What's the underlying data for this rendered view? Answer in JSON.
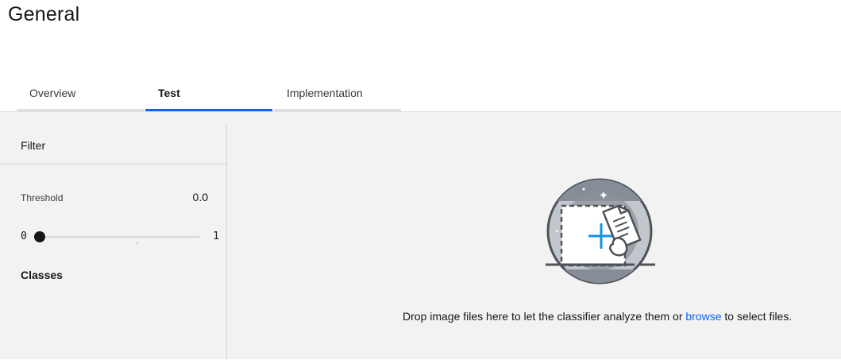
{
  "page": {
    "title": "General"
  },
  "tabs": [
    {
      "label": "Overview",
      "active": false
    },
    {
      "label": "Test",
      "active": true
    },
    {
      "label": "Implementation",
      "active": false
    }
  ],
  "sidebar": {
    "filter_label": "Filter",
    "threshold": {
      "label": "Threshold",
      "value": "0.0"
    },
    "slider": {
      "min": "0",
      "max": "1",
      "level_fraction": 0
    },
    "classes_heading": "Classes"
  },
  "dropzone": {
    "text_before": "Drop image files here to let the classifier analyze them or ",
    "link_text": "browse",
    "text_after": " to select files.",
    "illustration_icon": "image-upload-illustration"
  },
  "colors": {
    "accent": "#0f62fe",
    "panel_bg": "#f2f2f2",
    "icon_dark": "#4d5358",
    "icon_teal": "#1192e8"
  }
}
